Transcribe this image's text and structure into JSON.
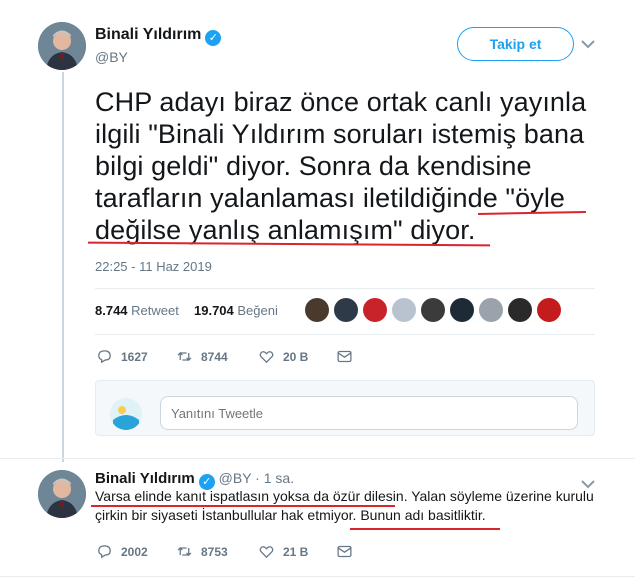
{
  "main_tweet": {
    "author_name": "Binali Yıldırım",
    "handle": "@BY",
    "follow_label": "Takip et",
    "text": "CHP adayı biraz önce ortak canlı yayınla\nilgili \"Binali Yıldırım soruları istemiş bana\nbilgi geldi\" diyor. Sonra da kendisine\ntarafların yalanlaması iletildiğinde \"öyle\ndeğilse yanlış anlamışım\" diyor.",
    "timestamp": "22:25 - 11 Haz 2019",
    "retweets_count": "8.744",
    "retweets_label": "Retweet",
    "likes_count": "19.704",
    "likes_label": "Beğeni",
    "liker_avatars": [
      "#4a3a2e",
      "#2f3a48",
      "#c8222a",
      "#b9c3cf",
      "#3b3b3b",
      "#1e2a36",
      "#9aa3ab",
      "#2a2a2a",
      "#c41c1c"
    ],
    "actions": {
      "replies": "1627",
      "retweets": "8744",
      "likes": "20 B"
    }
  },
  "reply_composer": {
    "placeholder": "Yanıtını Tweetle"
  },
  "reply_tweet": {
    "author_name": "Binali Yıldırım",
    "handle": "@BY",
    "separator": "·",
    "time": "1 sa.",
    "text": "Varsa elinde kanıt ispatlasın yoksa da özür dilesin. Yalan söyleme üzerine kurulu çirkin bir siyaseti İstanbullular hak etmiyor. Bunun adı basitliktir.",
    "actions": {
      "replies": "2002",
      "retweets": "8753",
      "likes": "21 B"
    }
  },
  "colors": {
    "accent": "#1da1f2",
    "annotation": "#d7262d",
    "muted": "#657786"
  }
}
